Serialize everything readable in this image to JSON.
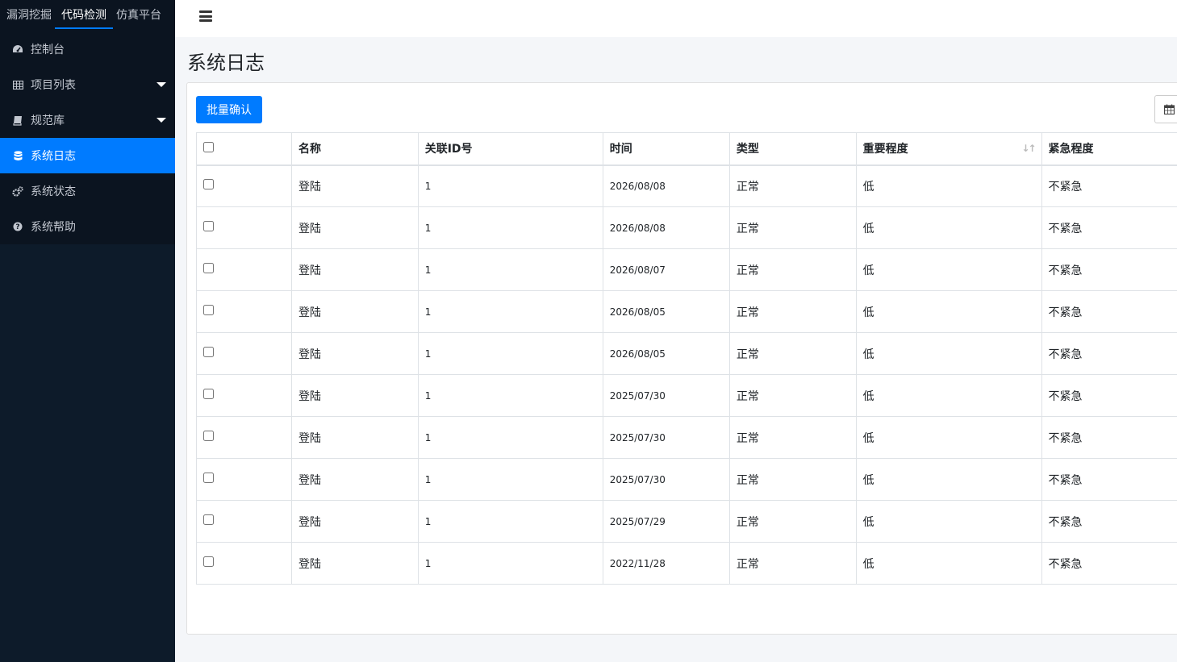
{
  "top_tabs": [
    "漏洞挖掘",
    "代码检测",
    "仿真平台"
  ],
  "active_tab_index": 1,
  "menu": [
    {
      "label": "控制台",
      "icon": "dashboard-icon",
      "has_submenu": false,
      "active": false
    },
    {
      "label": "项目列表",
      "icon": "table-icon",
      "has_submenu": true,
      "active": false
    },
    {
      "label": "规范库",
      "icon": "book-icon",
      "has_submenu": true,
      "active": false
    },
    {
      "label": "系统日志",
      "icon": "database-icon",
      "has_submenu": false,
      "active": true
    },
    {
      "label": "系统状态",
      "icon": "cogs-icon",
      "has_submenu": false,
      "active": false
    },
    {
      "label": "系统帮助",
      "icon": "question-circle-icon",
      "has_submenu": false,
      "active": false
    }
  ],
  "page_title": "系统日志",
  "batch_confirm_label": "批量确认",
  "table": {
    "headers": [
      "名称",
      "关联ID号",
      "时间",
      "类型",
      "重要程度",
      "紧急程度"
    ],
    "rows": [
      [
        "登陆",
        "1",
        "2026/08/08",
        "正常",
        "低",
        "不紧急"
      ],
      [
        "登陆",
        "1",
        "2026/08/08",
        "正常",
        "低",
        "不紧急"
      ],
      [
        "登陆",
        "1",
        "2026/08/07",
        "正常",
        "低",
        "不紧急"
      ],
      [
        "登陆",
        "1",
        "2026/08/05",
        "正常",
        "低",
        "不紧急"
      ],
      [
        "登陆",
        "1",
        "2026/08/05",
        "正常",
        "低",
        "不紧急"
      ],
      [
        "登陆",
        "1",
        "2025/07/30",
        "正常",
        "低",
        "不紧急"
      ],
      [
        "登陆",
        "1",
        "2025/07/30",
        "正常",
        "低",
        "不紧急"
      ],
      [
        "登陆",
        "1",
        "2025/07/30",
        "正常",
        "低",
        "不紧急"
      ],
      [
        "登陆",
        "1",
        "2025/07/29",
        "正常",
        "低",
        "不紧急"
      ],
      [
        "登陆",
        "1",
        "2022/11/28",
        "正常",
        "低",
        "不紧急"
      ]
    ]
  },
  "colors": {
    "sidebar_bg": "#0d1b2a",
    "accent": "#007bff",
    "content_bg": "#f4f6f9"
  }
}
